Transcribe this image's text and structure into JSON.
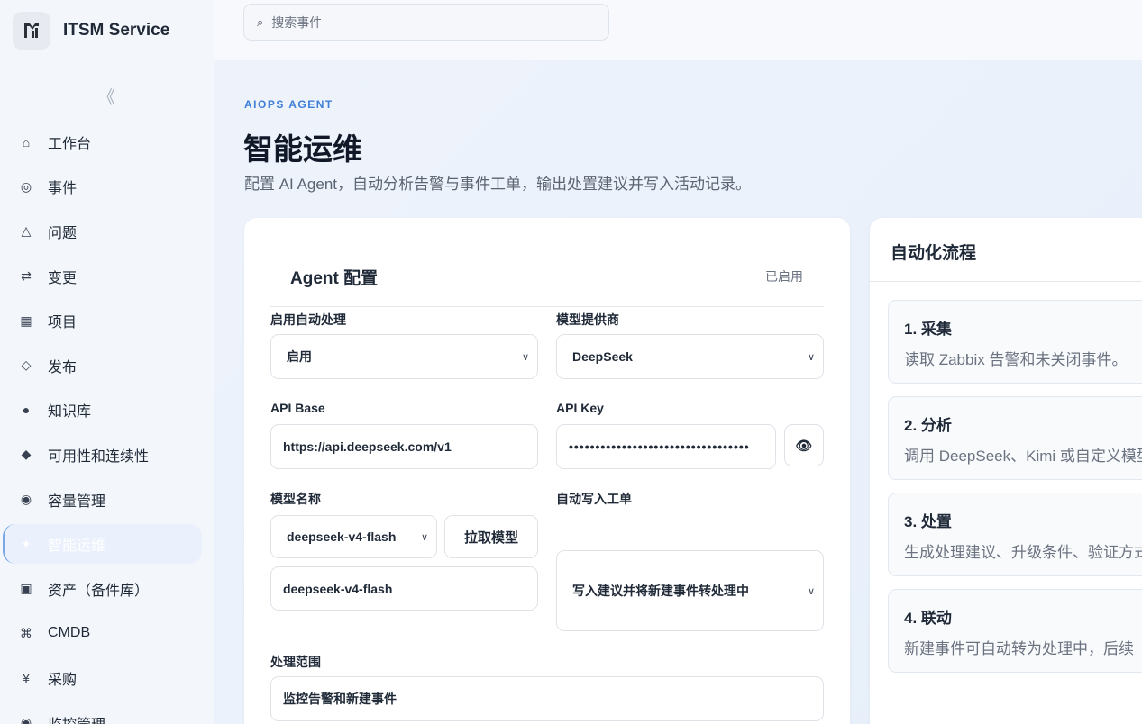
{
  "app": {
    "name": "ITSM Service",
    "logo_icon": "logo-icon"
  },
  "search": {
    "placeholder": "搜索事件",
    "value": ""
  },
  "sidebar": {
    "collapse_glyph": "《",
    "items": [
      {
        "label": "工作台",
        "icon": "home-icon"
      },
      {
        "label": "事件",
        "icon": "target-icon"
      },
      {
        "label": "问题",
        "icon": "triangle-icon"
      },
      {
        "label": "变更",
        "icon": "swap-icon"
      },
      {
        "label": "项目",
        "icon": "grid-icon"
      },
      {
        "label": "发布",
        "icon": "diamond-outline-icon"
      },
      {
        "label": "知识库",
        "icon": "dot-icon"
      },
      {
        "label": "可用性和连续性",
        "icon": "diamond-icon"
      },
      {
        "label": "容量管理",
        "icon": "database-icon"
      },
      {
        "label": "智能运维",
        "icon": "sparkle-icon",
        "active": true
      },
      {
        "label": "资产（备件库）",
        "icon": "box-icon"
      },
      {
        "label": "CMDB",
        "icon": "command-icon"
      },
      {
        "label": "采购",
        "icon": "yen-icon"
      },
      {
        "label": "监控管理",
        "icon": "monitor-icon"
      }
    ]
  },
  "page": {
    "eyebrow": "AIOPS AGENT",
    "title": "智能运维",
    "description": "配置 AI Agent，自动分析告警与事件工单，输出处置建议并写入活动记录。"
  },
  "config": {
    "title": "Agent 配置",
    "status": "已启用",
    "enable": {
      "label": "启用自动处理",
      "value": "启用"
    },
    "provider": {
      "label": "模型提供商",
      "value": "DeepSeek"
    },
    "api_base": {
      "label": "API Base",
      "value": "https://api.deepseek.com/v1"
    },
    "api_key": {
      "label": "API Key",
      "value": "••••••••••••••••••••••••••••••••••",
      "toggle_icon": "eye-icon"
    },
    "model": {
      "label": "模型名称",
      "selected": "deepseek-v4-flash",
      "input_value": "deepseek-v4-flash",
      "fetch_button": "拉取模型"
    },
    "auto_write": {
      "label": "自动写入工单",
      "value": "写入建议并将新建事件转处理中"
    },
    "scope": {
      "label": "处理范围",
      "value": "监控告警和新建事件"
    }
  },
  "flow": {
    "title": "自动化流程",
    "steps": [
      {
        "title": "1. 采集",
        "desc": "读取 Zabbix 告警和未关闭事件。"
      },
      {
        "title": "2. 分析",
        "desc": "调用 DeepSeek、Kimi 或自定义模型"
      },
      {
        "title": "3. 处置",
        "desc": "生成处理建议、升级条件、验证方式"
      },
      {
        "title": "4. 联动",
        "desc": "新建事件可自动转为处理中，后续"
      }
    ]
  }
}
